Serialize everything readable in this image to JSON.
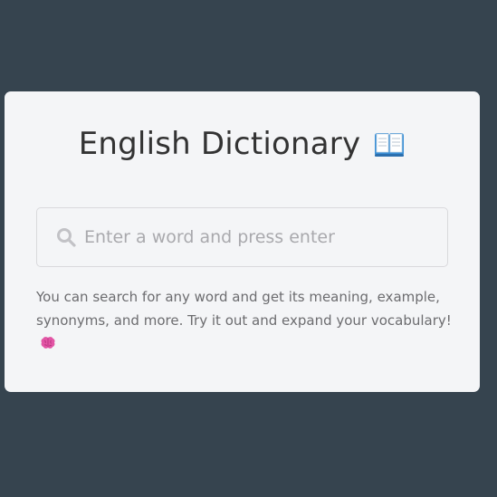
{
  "app": {
    "title": "English Dictionary",
    "title_icon": "open-book-icon"
  },
  "search": {
    "icon": "search-icon",
    "placeholder": "Enter a word and press enter",
    "value": ""
  },
  "info": {
    "text": "You can search for any word and get its meaning, example, synonyms, and more. Try it out and expand your vocabulary!",
    "icon": "brain-icon"
  },
  "colors": {
    "background": "#36444f",
    "card": "#f4f5f7",
    "title": "#333333",
    "placeholder": "#a9a9ad",
    "hint": "#6c6c6f",
    "brain": "#e255a5",
    "book": "#3a8fd6"
  }
}
